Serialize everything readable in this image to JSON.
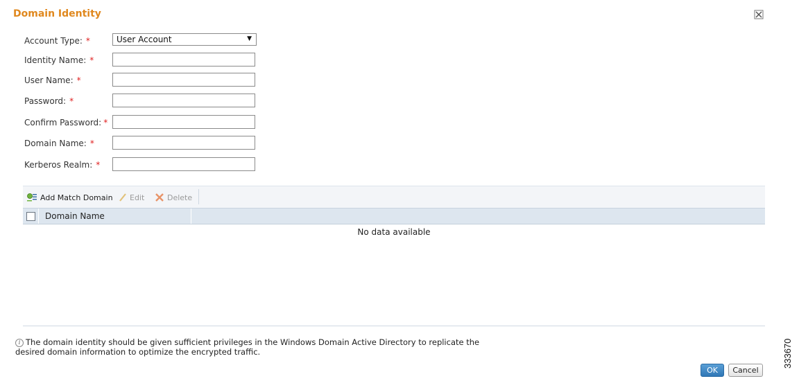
{
  "dialog": {
    "title": "Domain Identity",
    "close_icon": "close-icon"
  },
  "form": {
    "account_type": {
      "label": "Account Type:",
      "required": "*",
      "value": "User Account",
      "arrow": "▼"
    },
    "identity_name": {
      "label": "Identity Name:",
      "required": "*",
      "value": ""
    },
    "user_name": {
      "label": "User Name:",
      "required": "*",
      "value": ""
    },
    "password": {
      "label": "Password:",
      "required": "*",
      "value": ""
    },
    "confirm_password": {
      "label": "Confirm Password:",
      "required": "*",
      "value": ""
    },
    "domain_name": {
      "label": "Domain Name:",
      "required": "*",
      "value": ""
    },
    "kerberos_realm": {
      "label": "Kerberos Realm:",
      "required": "*",
      "value": ""
    }
  },
  "grid": {
    "toolbar": {
      "add_label": "Add Match Domain",
      "edit_label": "Edit",
      "delete_label": "Delete"
    },
    "columns": [
      "Domain Name"
    ],
    "empty_text": "No data available"
  },
  "footer": {
    "note": "The domain identity should be given sufficient privileges in the Windows Domain Active Directory to replicate the desired domain information to optimize the encrypted traffic.",
    "ok_label": "OK",
    "cancel_label": "Cancel"
  },
  "figure_id": "333670",
  "colors": {
    "title": "#e0881e",
    "required": "#e01e1e",
    "ok_button": "#2f77b6",
    "grid_header": "#dde6ef"
  }
}
